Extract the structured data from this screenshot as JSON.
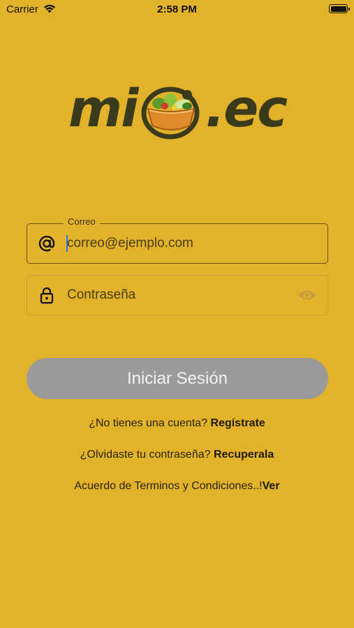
{
  "status_bar": {
    "carrier": "Carrier",
    "time": "2:58 PM",
    "wifi_icon": "wifi-icon",
    "battery_icon": "battery-icon"
  },
  "logo": {
    "text_left": "mi",
    "text_right": ".ec",
    "bowl_icon": "vegetable-bowl-icon"
  },
  "email_field": {
    "label": "Correo",
    "placeholder": "correo@ejemplo.com",
    "value": "",
    "icon": "at-icon"
  },
  "password_field": {
    "placeholder": "Contraseña",
    "value": "",
    "icon": "lock-icon",
    "toggle_icon": "eye-icon"
  },
  "login_button": {
    "label": "Iniciar Sesión"
  },
  "register": {
    "prompt": "¿No tienes una cuenta? ",
    "link": "Regístrate"
  },
  "recover": {
    "prompt": "¿Olvidaste tu contraseña? ",
    "link": "Recuperala"
  },
  "terms": {
    "prompt": "Acuerdo de Terminos y Condiciones..!",
    "link": "Ver"
  },
  "colors": {
    "background": "#E2B22A",
    "button_disabled": "#9b9a98",
    "logo_text": "#3a3a1c"
  }
}
